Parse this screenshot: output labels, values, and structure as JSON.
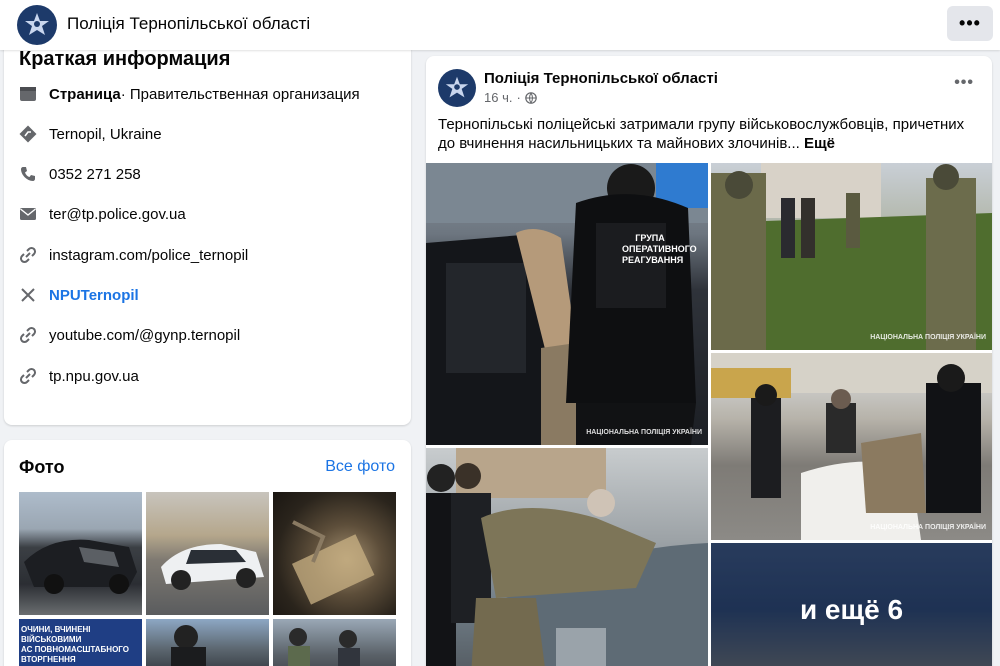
{
  "header": {
    "page_name": "Поліція Тернопільської області",
    "more_label": "•••"
  },
  "intro": {
    "title": "Краткая информация",
    "category_prefix": "Страница",
    "category_value": " · Правительственная организация",
    "location": "Ternopil, Ukraine",
    "phone": "0352 271 258",
    "email": "ter@tp.police.gov.ua",
    "instagram": "instagram.com/police_ternopil",
    "x_handle": "NPUTernopil",
    "youtube": "youtube.com/@gynp.ternopil",
    "website": "tp.npu.gov.ua"
  },
  "photos": {
    "title": "Фото",
    "all_link": "Все фото",
    "thumb_overlay_text_1": "ОЧИНИ, ВЧИНЕНІ ВІЙСЬКОВИМИ",
    "thumb_overlay_text_2": "АС ПОВНОМАСШТАБНОГО ВТОРГНЕННЯ"
  },
  "post": {
    "author": "Поліція Тернопільської області",
    "time": "16 ч.",
    "text": "Тернопільські поліцейські затримали групу військовослужбовців, причетних до вчинення насильницьких та майнових злочинів...",
    "more_label": "Ещё",
    "menu_label": "•••",
    "more_photos_label": "и ещё 6",
    "vest_text": "ГРУПА ОПЕРАТИВНОГО РЕАГУВАННЯ",
    "watermark": "НАЦІОНАЛЬНА ПОЛІЦІЯ УКРАЇНИ"
  },
  "colors": {
    "accent": "#1b74e4",
    "background": "#f0f2f5",
    "police_blue": "#1d3a6a"
  }
}
